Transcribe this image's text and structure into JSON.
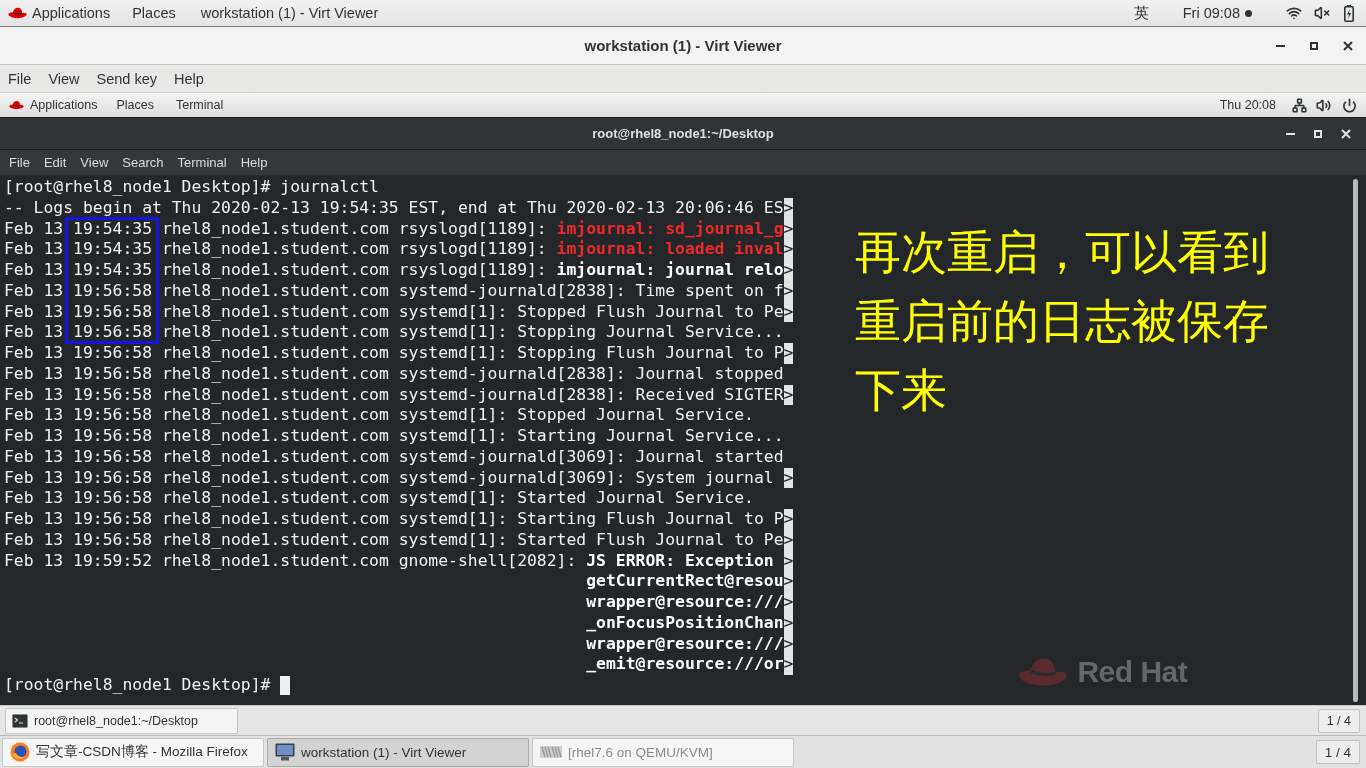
{
  "host_top_bar": {
    "menus": [
      "Applications",
      "Places"
    ],
    "app_title": "workstation (1) - Virt Viewer",
    "input_method": "英",
    "clock": "Fri 09:08",
    "notification": true
  },
  "viewer_window": {
    "title": "workstation (1) - Virt Viewer",
    "menu": [
      "File",
      "View",
      "Send key",
      "Help"
    ]
  },
  "guest_top_bar": {
    "menus": [
      "Applications",
      "Places",
      "Terminal"
    ],
    "clock": "Thu 20:08"
  },
  "terminal": {
    "title": "root@rhel8_node1:~/Desktop",
    "menu": [
      "File",
      "Edit",
      "View",
      "Search",
      "Terminal",
      "Help"
    ],
    "lines": [
      {
        "kind": "prompt",
        "text": "[root@rhel8_node1 Desktop]# journalctl",
        "cursor": false,
        "boxed": false
      },
      {
        "kind": "entry",
        "text": "-- Logs begin at Thu 2020-02-13 19:54:35 EST, end at Thu 2020-02-13 20:06:46 ES",
        "marker": ">",
        "boxed": false
      },
      {
        "kind": "entry",
        "text": "Feb 13 19:54:35 rhel8_node1.student.com rsyslogd[1189]:",
        "highlight": "imjournal: sd_journal_g",
        "color": "#ef2929",
        "marker": ">",
        "boxed": true
      },
      {
        "kind": "entry",
        "text": "Feb 13 19:54:35 rhel8_node1.student.com rsyslogd[1189]:",
        "highlight": "imjournal: loaded inval",
        "color": "#ef2929",
        "marker": ">",
        "boxed": true
      },
      {
        "kind": "entry",
        "text": "Feb 13 19:54:35 rhel8_node1.student.com rsyslogd[1189]:",
        "highlight": "imjournal: journal relo",
        "color": "#ffffff",
        "marker": ">",
        "boxed": true
      },
      {
        "kind": "entry",
        "text": "Feb 13 19:56:58 rhel8_node1.student.com systemd-journald[2838]: Time spent on f",
        "marker": ">",
        "boxed": true
      },
      {
        "kind": "entry",
        "text": "Feb 13 19:56:58 rhel8_node1.student.com systemd[1]: Stopped Flush Journal to Pe",
        "marker": ">",
        "boxed": true
      },
      {
        "kind": "entry",
        "text": "Feb 13 19:56:58 rhel8_node1.student.com systemd[1]: Stopping Journal Service...",
        "boxed": true
      },
      {
        "kind": "entry",
        "text": "Feb 13 19:56:58 rhel8_node1.student.com systemd[1]: Stopping Flush Journal to P",
        "marker": ">",
        "boxed": false
      },
      {
        "kind": "entry",
        "text": "Feb 13 19:56:58 rhel8_node1.student.com systemd-journald[2838]: Journal stopped",
        "boxed": false
      },
      {
        "kind": "entry",
        "text": "Feb 13 19:56:58 rhel8_node1.student.com systemd-journald[2838]: Received SIGTER",
        "marker": ">",
        "boxed": false
      },
      {
        "kind": "entry",
        "text": "Feb 13 19:56:58 rhel8_node1.student.com systemd[1]: Stopped Journal Service.",
        "boxed": false
      },
      {
        "kind": "entry",
        "text": "Feb 13 19:56:58 rhel8_node1.student.com systemd[1]: Starting Journal Service...",
        "boxed": false
      },
      {
        "kind": "entry",
        "text": "Feb 13 19:56:58 rhel8_node1.student.com systemd-journald[3069]: Journal started",
        "boxed": false
      },
      {
        "kind": "entry",
        "text": "Feb 13 19:56:58 rhel8_node1.student.com systemd-journald[3069]: System journal",
        "marker": ">",
        "boxed": false
      },
      {
        "kind": "entry",
        "text": "Feb 13 19:56:58 rhel8_node1.student.com systemd[1]: Started Journal Service.",
        "boxed": false
      },
      {
        "kind": "entry",
        "text": "Feb 13 19:56:58 rhel8_node1.student.com systemd[1]: Starting Flush Journal to P",
        "marker": ">",
        "boxed": false
      },
      {
        "kind": "entry",
        "text": "Feb 13 19:56:58 rhel8_node1.student.com systemd[1]: Started Flush Journal to Pe",
        "marker": ">",
        "boxed": false
      },
      {
        "kind": "entry",
        "text": "Feb 13 19:59:52 rhel8_node1.student.com gnome-shell[2082]:",
        "highlight": "JS ERROR: Exception",
        "color": "#ffffff",
        "marker": ">",
        "boxed": false
      },
      {
        "kind": "continuation",
        "highlight": "getCurrentRect@resou",
        "color": "#ffffff",
        "marker": ">",
        "boxed": false
      },
      {
        "kind": "continuation",
        "highlight": "wrapper@resource:///",
        "color": "#ffffff",
        "marker": ">",
        "boxed": false
      },
      {
        "kind": "continuation",
        "highlight": "_onFocusPositionChan",
        "color": "#ffffff",
        "marker": ">",
        "boxed": false
      },
      {
        "kind": "continuation",
        "highlight": "wrapper@resource:///",
        "color": "#ffffff",
        "marker": ">",
        "boxed": false
      },
      {
        "kind": "continuation",
        "highlight": "_emit@resource:///or",
        "color": "#ffffff",
        "marker": ">",
        "boxed": false
      },
      {
        "kind": "prompt",
        "text": "[root@rhel8_node1 Desktop]#",
        "cursor": true,
        "boxed": false
      }
    ]
  },
  "annotation": {
    "text": "再次重启，可以看到重启前的日志被保存下来"
  },
  "desktop_logo": {
    "text": "Red Hat"
  },
  "guest_taskbar": {
    "tasks": [
      {
        "label": "root@rhel8_node1:~/Desktop",
        "selected": false
      }
    ],
    "workspace": "1 / 4"
  },
  "host_taskbar": {
    "tasks": [
      {
        "kind": "browser",
        "label": "写文章-CSDN博客 - Mozilla Firefox",
        "selected": false,
        "minimized": false
      },
      {
        "kind": "viewer",
        "label": "workstation (1) - Virt Viewer",
        "selected": true,
        "minimized": false
      },
      {
        "kind": "vm",
        "label": "[rhel7.6 on QEMU/KVM]",
        "selected": false,
        "minimized": true
      }
    ],
    "workspace": "1 / 4"
  }
}
